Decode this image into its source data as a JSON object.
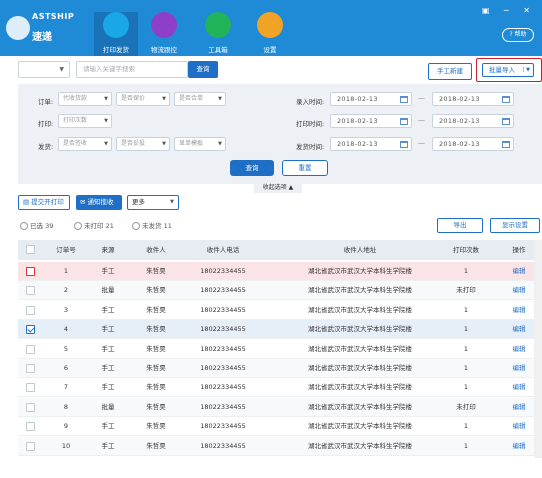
{
  "header": {
    "logo_text": "ASTSHIP",
    "logo_sub": "速递",
    "nav": [
      {
        "label": "打印发货",
        "color": "#1aa7e8"
      },
      {
        "label": "物流跟控",
        "color": "#8e3fc9"
      },
      {
        "label": "工具箱",
        "color": "#21b35a"
      },
      {
        "label": "设置",
        "color": "#f0a325"
      }
    ],
    "help_label": "帮助"
  },
  "search": {
    "placeholder": "请输入关键字搜索",
    "button": "查询",
    "manual_new": "手工新建",
    "batch_import": "批量导入"
  },
  "filters": {
    "order_label": "订单:",
    "order_opts": [
      "代收货款",
      "是否保价",
      "是否合单"
    ],
    "print_label": "打印:",
    "print_opts": [
      "打印次数"
    ],
    "ship_label": "发货:",
    "ship_opts": [
      "是否签收",
      "是否妥投",
      "显单模板"
    ],
    "entry_time_label": "录入时间:",
    "print_time_label": "打印时间:",
    "ship_time_label": "发货时间:",
    "date_value": "2018-02-13",
    "dash": "—",
    "query_btn": "查询",
    "reset_btn": "重置",
    "collapse": "收起选项 ▲"
  },
  "actions": {
    "submit_print": "提交开打印",
    "notify_pickup": "通知揽收",
    "more": "更多"
  },
  "stats": {
    "selected": "已选 39",
    "unprinted": "未打印 21",
    "unshipped": "未发货 11"
  },
  "toolbar": {
    "export": "导出",
    "display_settings": "显示设置"
  },
  "table": {
    "headers": [
      "订单号",
      "来源",
      "收件人",
      "收件人电话",
      "收件人地址",
      "打印次数",
      "操作"
    ],
    "rows": [
      {
        "no": "1",
        "src": "手工",
        "name": "朱哲昊",
        "phone": "18022334455",
        "addr": "湖北省武汉市武汉大学本科生学院楼",
        "print": "1",
        "op": "编辑"
      },
      {
        "no": "2",
        "src": "批量",
        "name": "朱哲昊",
        "phone": "18022334455",
        "addr": "湖北省武汉市武汉大学本科生学院楼",
        "print": "未打印",
        "op": "编辑"
      },
      {
        "no": "3",
        "src": "手工",
        "name": "朱哲昊",
        "phone": "18022334455",
        "addr": "湖北省武汉市武汉大学本科生学院楼",
        "print": "1",
        "op": "编辑"
      },
      {
        "no": "4",
        "src": "手工",
        "name": "朱哲昊",
        "phone": "18022334455",
        "addr": "湖北省武汉市武汉大学本科生学院楼",
        "print": "1",
        "op": "编辑"
      },
      {
        "no": "5",
        "src": "手工",
        "name": "朱哲昊",
        "phone": "18022334455",
        "addr": "湖北省武汉市武汉大学本科生学院楼",
        "print": "1",
        "op": "编辑"
      },
      {
        "no": "6",
        "src": "手工",
        "name": "朱哲昊",
        "phone": "18022334455",
        "addr": "湖北省武汉市武汉大学本科生学院楼",
        "print": "1",
        "op": "编辑"
      },
      {
        "no": "7",
        "src": "手工",
        "name": "朱哲昊",
        "phone": "18022334455",
        "addr": "湖北省武汉市武汉大学本科生学院楼",
        "print": "1",
        "op": "编辑"
      },
      {
        "no": "8",
        "src": "批量",
        "name": "朱哲昊",
        "phone": "18022334455",
        "addr": "湖北省武汉市武汉大学本科生学院楼",
        "print": "未打印",
        "op": "编辑"
      },
      {
        "no": "9",
        "src": "手工",
        "name": "朱哲昊",
        "phone": "18022334455",
        "addr": "湖北省武汉市武汉大学本科生学院楼",
        "print": "1",
        "op": "编辑"
      },
      {
        "no": "10",
        "src": "手工",
        "name": "朱哲昊",
        "phone": "18022334455",
        "addr": "湖北省武汉市武汉大学本科生学院楼",
        "print": "1",
        "op": "编辑"
      }
    ]
  }
}
